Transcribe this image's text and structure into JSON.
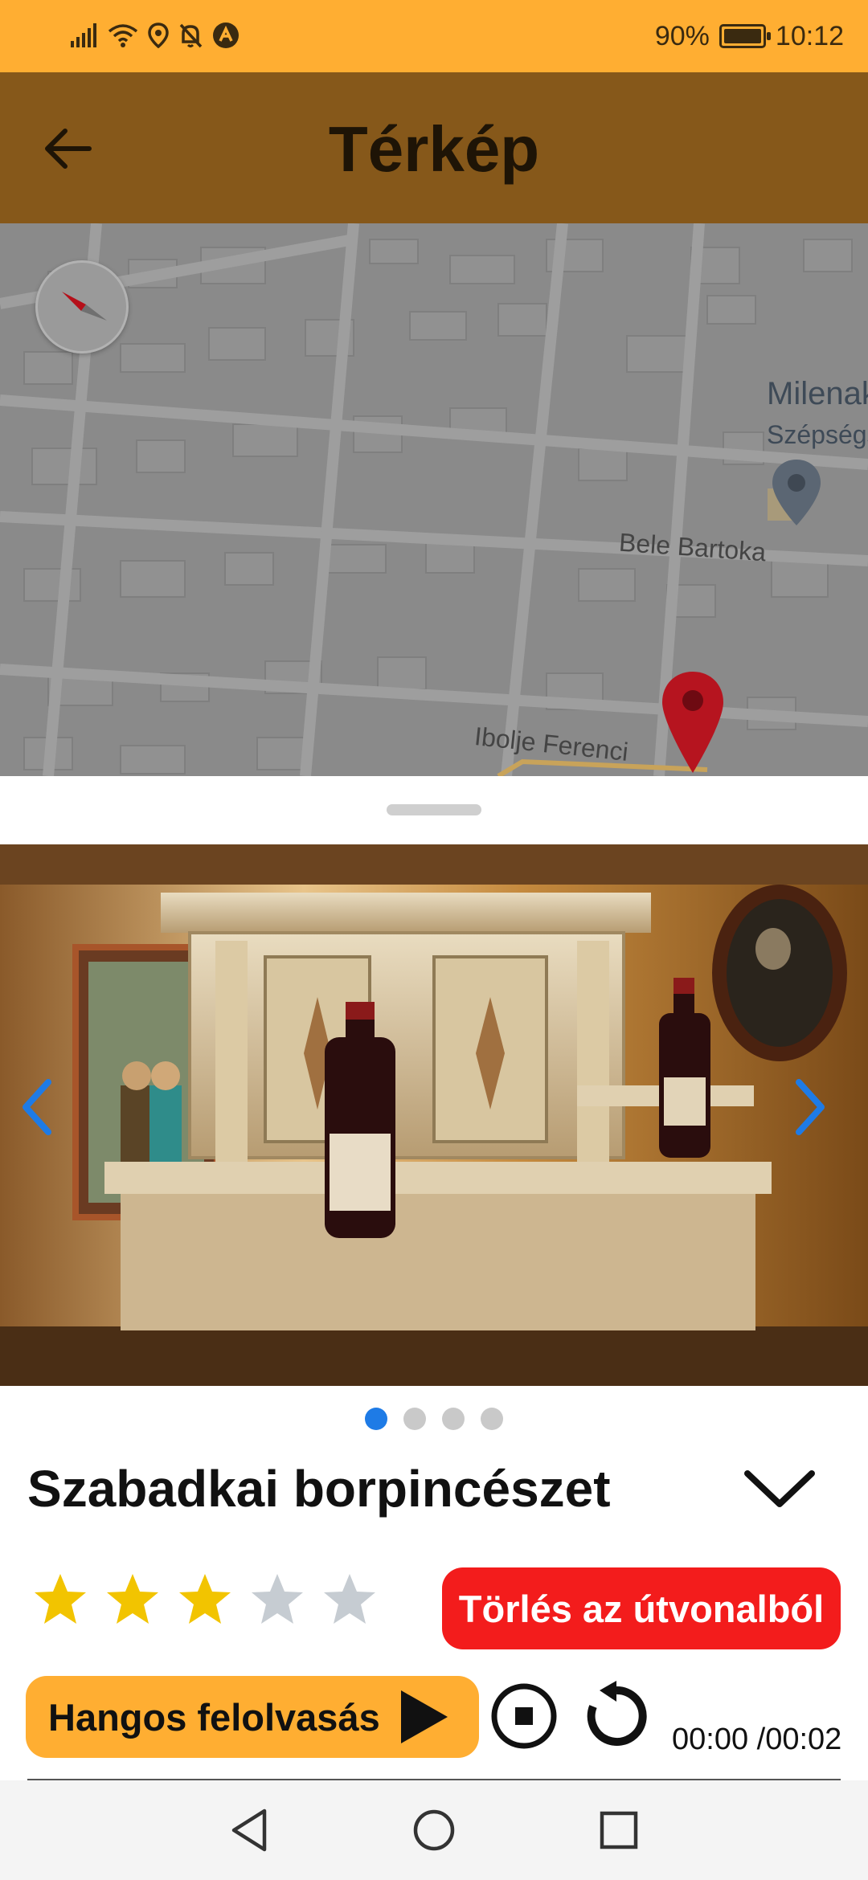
{
  "status_bar": {
    "battery": "90%",
    "battery_level": 0.9,
    "time": "10:12",
    "icons": [
      "signal-icon",
      "wifi-icon",
      "location-icon",
      "notifications-off-icon",
      "app-notification-icon"
    ]
  },
  "app_bar": {
    "title": "Térkép",
    "back_icon": "arrow-left-icon"
  },
  "map": {
    "poi_name": "Milenak",
    "poi_subtitle": "Szépségs",
    "street_labels": [
      "Bele Bartoka",
      "Ibolje Ferenci"
    ],
    "icons": [
      "compass-icon",
      "poi-pin-icon",
      "destination-pin-icon"
    ]
  },
  "place": {
    "title": "Szabadkai borpincészet",
    "rating": 3,
    "rating_max": 5,
    "carousel_count": 4,
    "carousel_active_index": 0,
    "remove_label": "Törlés az útvonalból",
    "read_aloud_label": "Hangos felolvasás",
    "time_readout": "00:00 /00:02"
  },
  "colors": {
    "status_bar": "#FFAE32",
    "app_bar": "#86581A",
    "accent_orange": "#FFAE32",
    "danger_red": "#F31C1C",
    "dot_active": "#1E7BE6",
    "star_filled": "#F2C400",
    "star_empty": "#C6CCD2",
    "carousel_arrow": "#1E7BE6"
  }
}
